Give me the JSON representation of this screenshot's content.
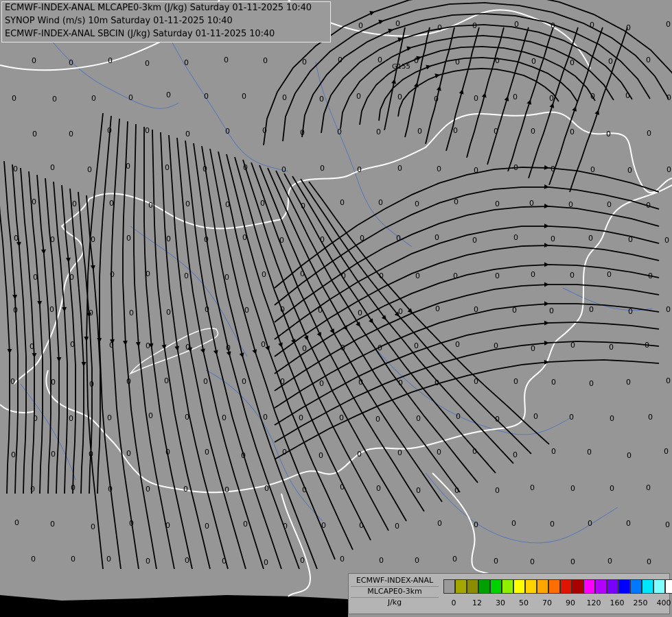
{
  "header": {
    "line1": "ECMWF-INDEX-ANAL MLCAPE0-3km (J/kg) Saturday 01-11-2025 10:40",
    "line2": "SYNOP Wind (m/s) 10m Saturday 01-11-2025 10:40",
    "line3": "ECMWF-INDEX-ANAL SBCIN (J/kg) Saturday 01-11-2025 10:40"
  },
  "legend": {
    "title1": "ECMWF-INDEX-ANAL",
    "title2": "MLCAPE0-3km",
    "unit": "J/kg",
    "colors": [
      "#9a9a9a",
      "#a6a600",
      "#8c8c00",
      "#00a000",
      "#00d200",
      "#90ee00",
      "#ffff00",
      "#ffd200",
      "#ffa500",
      "#ff6e00",
      "#e11400",
      "#aa0000",
      "#ff00ff",
      "#b400ff",
      "#7800ff",
      "#0000ff",
      "#0078ff",
      "#00e6ff",
      "#80ffff",
      "#ffffff"
    ],
    "tick_labels": [
      "0",
      "12",
      "30",
      "50",
      "70",
      "90",
      "120",
      "160",
      "250",
      "400"
    ],
    "tick_index": [
      1,
      3,
      5,
      7,
      9,
      11,
      13,
      15,
      17,
      19
    ]
  },
  "map": {
    "station_value": "0",
    "city_label": "G155",
    "colors": {
      "background": "#969696",
      "borders": "#ffffff",
      "rivers": "#5a78b4",
      "streamlines": "#000000",
      "sea": "#000000"
    }
  }
}
